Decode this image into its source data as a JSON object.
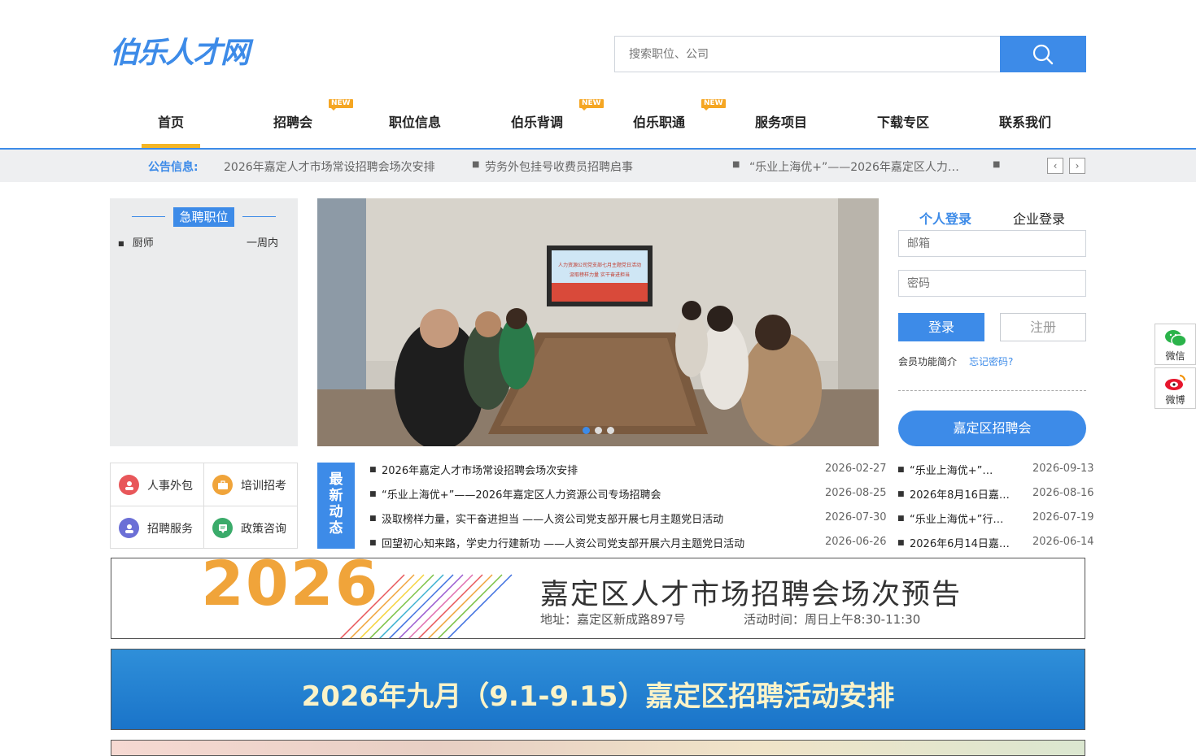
{
  "logo": {
    "text": "伯乐人才网"
  },
  "search": {
    "placeholder": "搜索职位、公司"
  },
  "nav": {
    "items": [
      {
        "label": "首页",
        "new": false
      },
      {
        "label": "招聘会",
        "new": true
      },
      {
        "label": "职位信息",
        "new": false
      },
      {
        "label": "伯乐背调",
        "new": true
      },
      {
        "label": "伯乐职通",
        "new": true
      },
      {
        "label": "服务项目",
        "new": false
      },
      {
        "label": "下载专区",
        "new": false
      },
      {
        "label": "联系我们",
        "new": false
      }
    ],
    "new_badge": "NEW"
  },
  "notice": {
    "label": "公告信息:",
    "items": [
      "2026年嘉定人才市场常设招聘会场次安排",
      "劳务外包挂号收费员招聘启事",
      "“乐业上海优+”——2026年嘉定区人力…"
    ],
    "prev": "‹",
    "next": "›"
  },
  "urgent": {
    "title": "急聘职位",
    "jobs": [
      {
        "name": "厨师",
        "time": "一周内"
      }
    ]
  },
  "banner": {
    "slides": 3,
    "active": 0,
    "screen_title": "人力资源公司党支部七月主题党日活动",
    "screen_sub": "汲取榜样力量 实干奋进担当"
  },
  "login": {
    "tab_personal": "个人登录",
    "tab_company": "企业登录",
    "email_placeholder": "邮箱",
    "password_placeholder": "密码",
    "login_label": "登录",
    "register_label": "注册",
    "intro_link": "会员功能简介",
    "forgot_link": "忘记密码?",
    "fair_button": "嘉定区招聘会"
  },
  "float": {
    "wechat": "微信",
    "weibo": "微博"
  },
  "services": [
    {
      "label": "人事外包",
      "color": "#e8575a"
    },
    {
      "label": "培训招考",
      "color": "#f0a43a"
    },
    {
      "label": "招聘服务",
      "color": "#6b6fd6"
    },
    {
      "label": "政策咨询",
      "color": "#3aab6a"
    }
  ],
  "news": {
    "tag": "最新动态",
    "left": [
      {
        "title": "2026年嘉定人才市场常设招聘会场次安排",
        "date": "2026-02-27"
      },
      {
        "title": "“乐业上海优+”——2026年嘉定区人力资源公司专场招聘会",
        "date": "2026-08-25"
      },
      {
        "title": "汲取榜样力量，实干奋进担当 ——人资公司党支部开展七月主题党日活动",
        "date": "2026-07-30"
      },
      {
        "title": "回望初心知来路，学史力行建新功 ——人资公司党支部开展六月主题党日活动",
        "date": "2026-06-26"
      }
    ],
    "right": [
      {
        "title": "“乐业上海优+”…",
        "date": "2026-09-13"
      },
      {
        "title": "2026年8月16日嘉…",
        "date": "2026-08-16"
      },
      {
        "title": "“乐业上海优+”行…",
        "date": "2026-07-19"
      },
      {
        "title": "2026年6月14日嘉…",
        "date": "2026-06-14"
      }
    ]
  },
  "ad1": {
    "year": "2026",
    "title": "嘉定区人才市场招聘会场次预告",
    "address": "地址：嘉定区新成路897号",
    "time": "活动时间：周日上午8:30-11:30"
  },
  "ad2": {
    "title": "2026年九月（9.1-9.15）嘉定区招聘活动安排"
  }
}
